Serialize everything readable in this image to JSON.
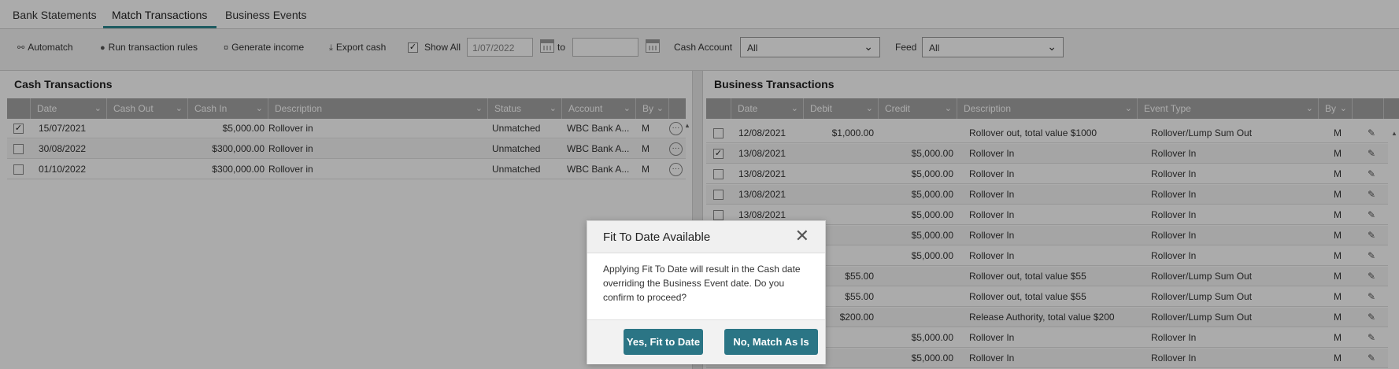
{
  "tabs": [
    "Bank Statements",
    "Match Transactions",
    "Business Events"
  ],
  "toolbar": {
    "automatch": "Automatch",
    "run_rules": "Run transaction rules",
    "generate_income": "Generate income",
    "export_cash": "Export cash",
    "show_all": "Show All",
    "date_from": "1/07/2022",
    "date_to": "",
    "to_label": "to",
    "cash_account_label": "Cash Account",
    "cash_account_value": "All",
    "feed_label": "Feed",
    "feed_value": "All"
  },
  "cash": {
    "title": "Cash Transactions",
    "headers": [
      "Date",
      "Cash Out",
      "Cash In",
      "Description",
      "Status",
      "Account",
      "By"
    ],
    "rows": [
      {
        "checked": true,
        "date": "15/07/2021",
        "cash_out": "",
        "cash_in": "$5,000.00",
        "description": "Rollover in",
        "status": "Unmatched",
        "account": "WBC Bank A...",
        "by": "M"
      },
      {
        "checked": false,
        "date": "30/08/2022",
        "cash_out": "",
        "cash_in": "$300,000.00",
        "description": "Rollover in",
        "status": "Unmatched",
        "account": "WBC Bank A...",
        "by": "M"
      },
      {
        "checked": false,
        "date": "01/10/2022",
        "cash_out": "",
        "cash_in": "$300,000.00",
        "description": "Rollover in",
        "status": "Unmatched",
        "account": "WBC Bank A...",
        "by": "M"
      }
    ]
  },
  "business": {
    "title": "Business Transactions",
    "headers": [
      "Date",
      "Debit",
      "Credit",
      "Description",
      "Event Type",
      "By"
    ],
    "rows": [
      {
        "checked": false,
        "date": "12/08/2021",
        "debit": "$1,000.00",
        "credit": "",
        "description": "Rollover out, total value $1000",
        "event_type": "Rollover/Lump Sum Out",
        "by": "M"
      },
      {
        "checked": true,
        "date": "13/08/2021",
        "debit": "",
        "credit": "$5,000.00",
        "description": "Rollover In",
        "event_type": "Rollover In",
        "by": "M"
      },
      {
        "checked": false,
        "date": "13/08/2021",
        "debit": "",
        "credit": "$5,000.00",
        "description": "Rollover In",
        "event_type": "Rollover In",
        "by": "M"
      },
      {
        "checked": false,
        "date": "13/08/2021",
        "debit": "",
        "credit": "$5,000.00",
        "description": "Rollover In",
        "event_type": "Rollover In",
        "by": "M"
      },
      {
        "checked": false,
        "date": "13/08/2021",
        "debit": "",
        "credit": "$5,000.00",
        "description": "Rollover In",
        "event_type": "Rollover In",
        "by": "M"
      },
      {
        "checked": false,
        "date": "",
        "debit": "",
        "credit": "$5,000.00",
        "description": "Rollover In",
        "event_type": "Rollover In",
        "by": "M"
      },
      {
        "checked": false,
        "date": "",
        "debit": "",
        "credit": "$5,000.00",
        "description": "Rollover In",
        "event_type": "Rollover In",
        "by": "M"
      },
      {
        "checked": false,
        "date": "",
        "debit": "$55.00",
        "credit": "",
        "description": "Rollover out, total value $55",
        "event_type": "Rollover/Lump Sum Out",
        "by": "M"
      },
      {
        "checked": false,
        "date": "",
        "debit": "$55.00",
        "credit": "",
        "description": "Rollover out, total value $55",
        "event_type": "Rollover/Lump Sum Out",
        "by": "M"
      },
      {
        "checked": false,
        "date": "",
        "debit": "$200.00",
        "credit": "",
        "description": "Release Authority, total value $200",
        "event_type": "Rollover/Lump Sum Out",
        "by": "M"
      },
      {
        "checked": false,
        "date": "",
        "debit": "",
        "credit": "$5,000.00",
        "description": "Rollover In",
        "event_type": "Rollover In",
        "by": "M"
      },
      {
        "checked": false,
        "date": "",
        "debit": "",
        "credit": "$5,000.00",
        "description": "Rollover In",
        "event_type": "Rollover In",
        "by": "M"
      }
    ]
  },
  "modal": {
    "title": "Fit To Date Available",
    "body": "Applying Fit To Date will result in the Cash date overriding the Business Event date. Do you confirm to proceed?",
    "yes_label": "Yes, Fit to Date",
    "no_label": "No, Match As Is"
  },
  "colors": {
    "accent": "#2f8a91",
    "button": "#2b7585",
    "header_bg": "#a4a4a4"
  },
  "icons": {
    "close": "close-icon",
    "edit": "pencil-icon",
    "more": "ellipsis-icon",
    "calendar": "calendar-icon"
  }
}
